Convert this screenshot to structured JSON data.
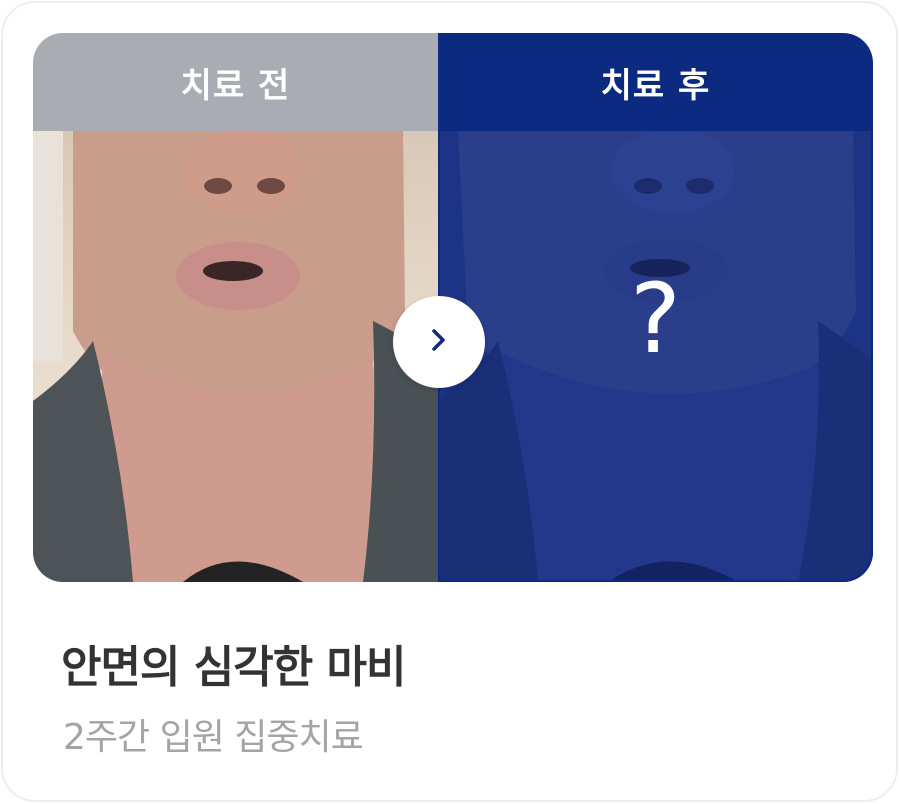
{
  "comparison": {
    "before_label": "치료 전",
    "after_label": "치료 후",
    "after_placeholder": "?",
    "next_icon": "chevron-right-icon"
  },
  "caption": {
    "title": "안면의 심각한 마비",
    "subtitle": "2주간 입원 집중치료"
  },
  "colors": {
    "before_header": "#a9acb3",
    "after_header": "#0c2a80",
    "title": "#333333",
    "subtitle": "#a4a4a4"
  }
}
